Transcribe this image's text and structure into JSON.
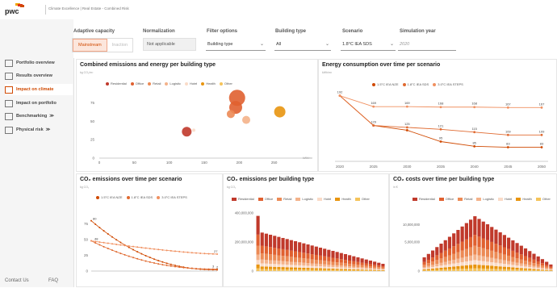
{
  "header": {
    "brand": "pwc",
    "breadcrumb": "Climate Excellence | Real Estate - Combined Risk"
  },
  "sidebar": {
    "items": [
      {
        "label": "Portfolio overview",
        "icon": "portfolio-icon",
        "active": false
      },
      {
        "label": "Results overview",
        "icon": "results-icon",
        "active": false
      },
      {
        "label": "Impact on climate",
        "icon": "climate-icon",
        "active": true
      },
      {
        "label": "Impact on portfolio",
        "icon": "portfolio-impact-icon",
        "active": false
      },
      {
        "label": "Benchmarking",
        "icon": "benchmark-icon",
        "active": false
      },
      {
        "label": "Physical risk",
        "icon": "physical-risk-icon",
        "active": false
      }
    ],
    "contact": "Contact Us",
    "faq": "FAQ"
  },
  "filters": {
    "adaptive_label": "Adaptive capacity",
    "adaptive_options": [
      "Mainstream",
      "Inaction"
    ],
    "normalization_label": "Normalization",
    "normalization_value": "Not applicable",
    "filter_label": "Filter options",
    "filter_value": "Building type",
    "building_label": "Building type",
    "building_value": "All",
    "scenario_label": "Scenario",
    "scenario_value": "1.8°C IEA SDS",
    "year_label": "Simulation year",
    "year_placeholder": "2020"
  },
  "colors": {
    "accent": "#d04a02",
    "residential": "#c0392b",
    "office": "#e06030",
    "retail": "#ec8a55",
    "logistic": "#f4b28a",
    "hotel": "#fadbc8",
    "health": "#e8950f",
    "other": "#f5c35a"
  },
  "charts": {
    "bubble": {
      "title": "Combined emissions and energy per building type",
      "unit": "kg CO₂/m²",
      "xunit": "kWh/m²",
      "legend": [
        "Residential",
        "Office",
        "Retail",
        "Logistic",
        "Hotel",
        "Health",
        "Other"
      ]
    },
    "energy": {
      "title": "Energy consumption over time per scenario",
      "unit": "kWh/m²",
      "legend": [
        "1.5°C IEA NZE",
        "1.8°C IEA SDS",
        "3.0°C IEA STEPS"
      ]
    },
    "co2_scenario": {
      "title": "CO₂ emissions over time per scenario",
      "unit": "kg CO₂",
      "legend": [
        "1.5°C IEA NZE",
        "1.8°C IEA SDS",
        "3.0°C IEA STEPS"
      ]
    },
    "co2_building": {
      "title": "CO₂ emissions per building type",
      "unit": "kg CO₂",
      "legend": [
        "Residential",
        "Office",
        "Retail",
        "Logistic",
        "Hotel",
        "Health",
        "Other"
      ]
    },
    "cost_building": {
      "title": "CO₂ costs over time per building type",
      "unit": "in €",
      "legend": [
        "Residential",
        "Office",
        "Retail",
        "Logistic",
        "Hotel",
        "Health",
        "Other"
      ]
    }
  },
  "chart_data": [
    {
      "type": "scatter",
      "title": "Combined emissions and energy per building type",
      "xlabel": "kWh/m²",
      "ylabel": "kg CO₂/m²",
      "xlim": [
        0,
        300
      ],
      "ylim": [
        0,
        90
      ],
      "x_ticks": [
        0,
        50,
        100,
        150,
        200,
        250
      ],
      "y_ticks": [
        0,
        25,
        50,
        75
      ],
      "points": [
        {
          "name": "Residential",
          "x": 125,
          "y": 36,
          "size": 6
        },
        {
          "name": "Office",
          "x": 197,
          "y": 82,
          "size": 10
        },
        {
          "name": "Office",
          "x": 195,
          "y": 69,
          "size": 8
        },
        {
          "name": "Retail",
          "x": 188,
          "y": 60,
          "size": 5
        },
        {
          "name": "Logistic",
          "x": 210,
          "y": 52,
          "size": 5
        },
        {
          "name": "Hotel",
          "x": 135,
          "y": 38,
          "size": 2
        },
        {
          "name": "Health",
          "x": 258,
          "y": 63,
          "size": 7
        }
      ]
    },
    {
      "type": "line",
      "title": "Energy consumption over time per scenario",
      "x": [
        2020,
        2025,
        2030,
        2035,
        2040,
        2045,
        2050
      ],
      "series": [
        {
          "name": "1.5°C IEA NZE",
          "values": [
            192,
            129,
            119,
            95,
            85,
            83,
            83
          ]
        },
        {
          "name": "1.8°C IEA SDS",
          "values": [
            192,
            129,
            125,
            121,
            115,
            109,
            109
          ]
        },
        {
          "name": "3.0°C IEA STEPS",
          "values": [
            192,
            169,
            169,
            168,
            168,
            167,
            167
          ]
        }
      ],
      "data_labels": {
        "1.5°C IEA NZE": [
          "192",
          "",
          "",
          "95",
          "85",
          "83",
          "83"
        ],
        "1.8°C IEA SDS": [
          "",
          "129",
          "125",
          "121",
          "115",
          "109",
          "109"
        ],
        "3.0°C IEA STEPS": [
          "",
          "169",
          "169",
          "168",
          "168",
          "167",
          "167"
        ]
      }
    },
    {
      "type": "line",
      "title": "CO₂ emissions over time per scenario",
      "x_count": 31,
      "ylim": [
        0,
        100
      ],
      "y_ticks": [
        0,
        25,
        50,
        75
      ],
      "series": [
        {
          "name": "1.5°C IEA NZE",
          "start": 80,
          "end": 2
        },
        {
          "name": "1.8°C IEA SDS",
          "start": 48,
          "end": 3
        },
        {
          "name": "3.0°C IEA STEPS",
          "start": 48,
          "end": 27
        }
      ],
      "end_labels": [
        "27",
        "3",
        "2"
      ],
      "start_labels": [
        "80",
        "48"
      ]
    },
    {
      "type": "bar",
      "title": "CO₂ emissions per building type",
      "y_ticks": [
        "0",
        "200,000,000",
        "400,000,000"
      ],
      "ylim": [
        0,
        400000000
      ],
      "bar_count": 31,
      "first_bar_total": 380000000,
      "second_bar_total": 265000000,
      "last_bar_total": 50000000
    },
    {
      "type": "bar",
      "title": "CO₂ costs over time per building type",
      "y_ticks": [
        "0",
        "5,000,000",
        "10,000,000"
      ],
      "ylim": [
        0,
        12500000
      ],
      "bar_count": 31,
      "peak_total": 11800000
    }
  ]
}
